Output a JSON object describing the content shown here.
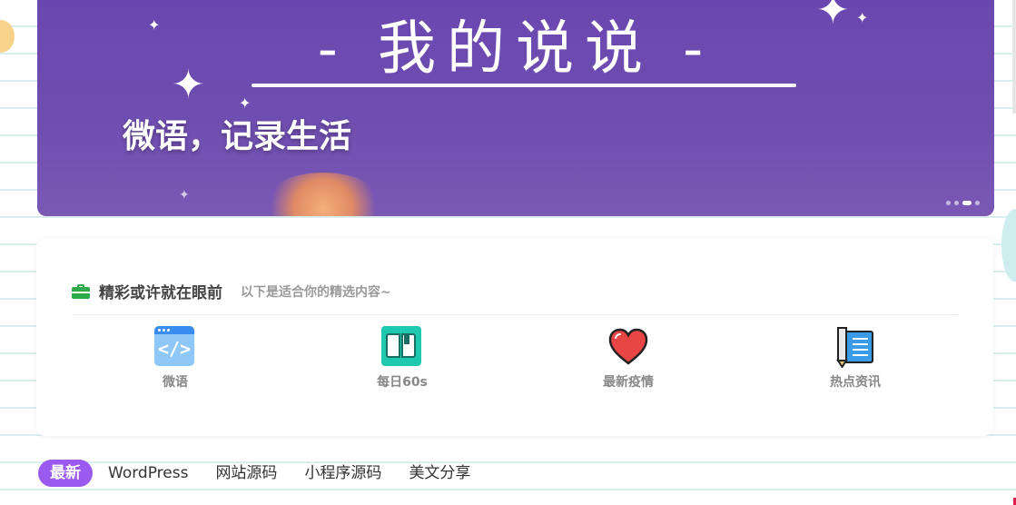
{
  "banner": {
    "title": "- 我的说说 -",
    "subtitle": "微语，记录生活",
    "slide_count": 4,
    "active_slide": 3
  },
  "feature_card": {
    "title": "精彩或许就在眼前",
    "subtitle": "以下是适合你的精选内容~",
    "items": [
      {
        "label": "微语",
        "icon": "code-window-icon"
      },
      {
        "label": "每日60s",
        "icon": "open-book-icon"
      },
      {
        "label": "最新疫情",
        "icon": "heart-icon"
      },
      {
        "label": "热点资讯",
        "icon": "notebook-pen-icon"
      }
    ]
  },
  "tabs": {
    "items": [
      "最新",
      "WordPress",
      "网站源码",
      "小程序源码",
      "美文分享"
    ],
    "active": "最新"
  },
  "colors": {
    "banner_bg": "#6e4eb0",
    "accent_tab": "#9b59f0",
    "briefcase_icon": "#2eaa4a",
    "heart": "#e84545",
    "book_icon": "#1fc9b0",
    "code_icon": "#8ec7f8"
  }
}
